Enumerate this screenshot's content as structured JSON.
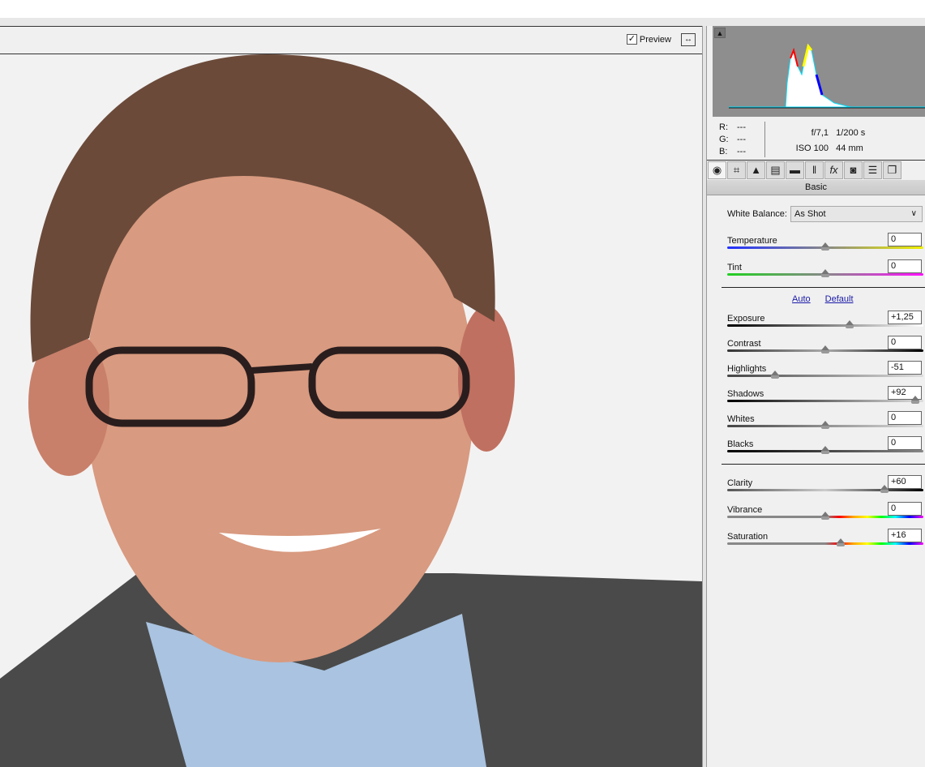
{
  "toolbar": {
    "preview_label": "Preview",
    "preview_checked": true
  },
  "histogram": {
    "r": "R:",
    "g": "G:",
    "b": "B:",
    "r_val": "---",
    "g_val": "---",
    "b_val": "---"
  },
  "exif": {
    "aperture": "f/7,1",
    "shutter": "1/200 s",
    "iso": "ISO 100",
    "focal": "44 mm"
  },
  "tabs": [
    "basic",
    "tone-curve",
    "detail",
    "hsl",
    "split-toning",
    "lens-corrections",
    "effects",
    "camera-calibration",
    "presets",
    "snapshots"
  ],
  "section_title": "Basic",
  "white_balance": {
    "label": "White Balance:",
    "value": "As Shot"
  },
  "links": {
    "auto": "Auto",
    "default": "Default"
  },
  "sliders": [
    {
      "label": "Temperature",
      "value": "0",
      "fraction": 0.5
    },
    {
      "label": "Tint",
      "value": "0",
      "fraction": 0.5
    },
    {
      "label": "Exposure",
      "value": "+1,25",
      "fraction": 0.625
    },
    {
      "label": "Contrast",
      "value": "0",
      "fraction": 0.5
    },
    {
      "label": "Highlights",
      "value": "-51",
      "fraction": 0.245
    },
    {
      "label": "Shadows",
      "value": "+92",
      "fraction": 0.96
    },
    {
      "label": "Whites",
      "value": "0",
      "fraction": 0.5
    },
    {
      "label": "Blacks",
      "value": "0",
      "fraction": 0.5
    },
    {
      "label": "Clarity",
      "value": "+60",
      "fraction": 0.8
    },
    {
      "label": "Vibrance",
      "value": "0",
      "fraction": 0.5
    },
    {
      "label": "Saturation",
      "value": "+16",
      "fraction": 0.58
    }
  ]
}
